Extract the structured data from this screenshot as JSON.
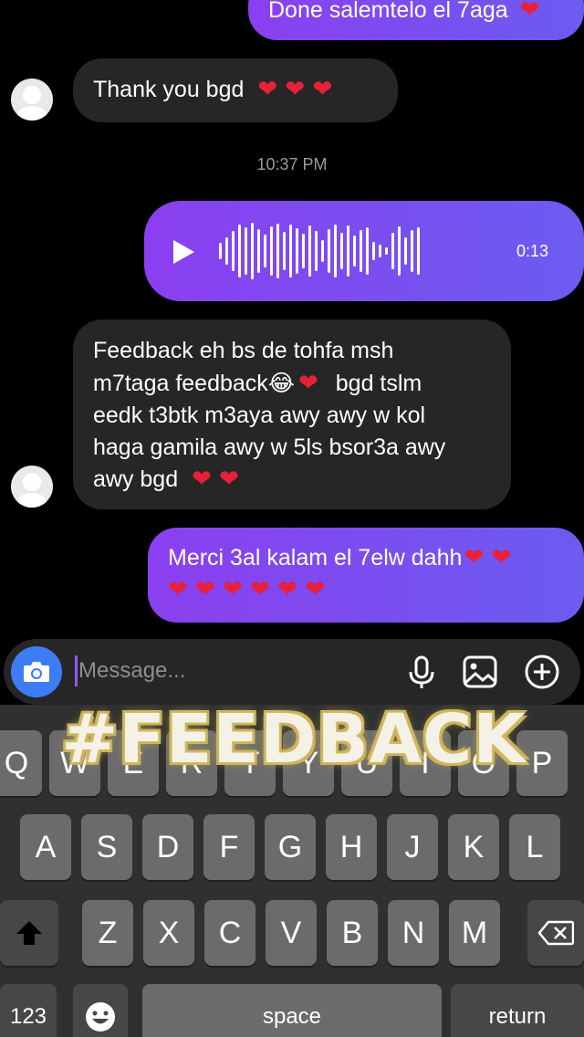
{
  "messages": {
    "top_partial_text": "Done salemtelo el 7aga",
    "thanks": {
      "text": "Thank you bgd",
      "hearts": "❤ ❤ ❤"
    },
    "timestamp": "10:37 PM",
    "voice": {
      "duration": "0:13"
    },
    "feedback": {
      "line1": "Feedback eh bs de tohfa msh",
      "line2": "m7taga feedback",
      "line2_emoji": "😂",
      "line2_heart": "❤",
      "line3": "bgd tslm",
      "line4": "eedk t3btk m3aya awy awy w kol",
      "line5": "haga gamila awy w 5ls bsor3a awy",
      "line6": "awy bgd",
      "line6_hearts": "❤ ❤"
    },
    "merci": {
      "line1": "Merci 3al kalam el 7elw dahh",
      "line1_hearts": "❤ ❤",
      "line2_hearts": "❤ ❤ ❤ ❤ ❤ ❤"
    }
  },
  "composer": {
    "placeholder": "Message..."
  },
  "keyboard": {
    "row1": [
      "Q",
      "W",
      "E",
      "R",
      "T",
      "Y",
      "U",
      "I",
      "O",
      "P"
    ],
    "row2": [
      "A",
      "S",
      "D",
      "F",
      "G",
      "H",
      "J",
      "K",
      "L"
    ],
    "row3": [
      "Z",
      "X",
      "C",
      "V",
      "B",
      "N",
      "M"
    ],
    "numbers_label": "123",
    "space_label": "space",
    "return_label": "return"
  },
  "overlay": {
    "sticker_text": "#FEEDBACK"
  },
  "colors": {
    "outgoing_bubble_start": "#8b3ff0",
    "outgoing_bubble_end": "#6b5cf0",
    "incoming_bubble": "#262626",
    "heart": "#e8203a",
    "camera_button": "#3e7cf5"
  },
  "icons": [
    "play-icon",
    "camera-icon",
    "microphone-icon",
    "gallery-icon",
    "plus-circle-icon",
    "emoji-icon",
    "shift-icon",
    "backspace-icon"
  ]
}
